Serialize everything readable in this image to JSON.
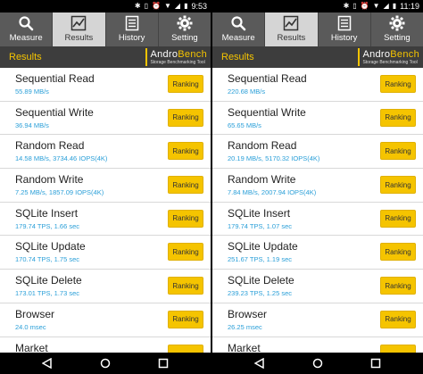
{
  "left": {
    "status": {
      "time": "9:53"
    },
    "tabs": [
      {
        "label": "Measure",
        "icon": "search-icon",
        "active": false
      },
      {
        "label": "Results",
        "icon": "chart-icon",
        "active": true
      },
      {
        "label": "History",
        "icon": "history-icon",
        "active": false
      },
      {
        "label": "Setting",
        "icon": "gear-icon",
        "active": false
      }
    ],
    "header": {
      "title": "Results",
      "brand_a": "Andro",
      "brand_b": "Bench",
      "tagline": "Storage Benchmarking Tool"
    },
    "rows": [
      {
        "name": "Sequential Read",
        "value": "55.89 MB/s",
        "button": "Ranking"
      },
      {
        "name": "Sequential Write",
        "value": "36.94 MB/s",
        "button": "Ranking"
      },
      {
        "name": "Random Read",
        "value": "14.58 MB/s, 3734.46 IOPS(4K)",
        "button": "Ranking"
      },
      {
        "name": "Random Write",
        "value": "7.25 MB/s, 1857.09 IOPS(4K)",
        "button": "Ranking"
      },
      {
        "name": "SQLite Insert",
        "value": "179.74 TPS, 1.66 sec",
        "button": "Ranking"
      },
      {
        "name": "SQLite Update",
        "value": "170.74 TPS, 1.75 sec",
        "button": "Ranking"
      },
      {
        "name": "SQLite Delete",
        "value": "173.01 TPS, 1.73 sec",
        "button": "Ranking"
      },
      {
        "name": "Browser",
        "value": "24.0 msec",
        "button": "Ranking"
      },
      {
        "name": "Market",
        "value": "",
        "button": ""
      }
    ]
  },
  "right": {
    "status": {
      "time": "11:19"
    },
    "tabs": [
      {
        "label": "Measure",
        "icon": "search-icon",
        "active": false
      },
      {
        "label": "Results",
        "icon": "chart-icon",
        "active": true
      },
      {
        "label": "History",
        "icon": "history-icon",
        "active": false
      },
      {
        "label": "Setting",
        "icon": "gear-icon",
        "active": false
      }
    ],
    "header": {
      "title": "Results",
      "brand_a": "Andro",
      "brand_b": "Bench",
      "tagline": "Storage Benchmarking Tool"
    },
    "rows": [
      {
        "name": "Sequential Read",
        "value": "220.68 MB/s",
        "button": "Ranking"
      },
      {
        "name": "Sequential Write",
        "value": "65.65 MB/s",
        "button": "Ranking"
      },
      {
        "name": "Random Read",
        "value": "20.19 MB/s, 5170.32 IOPS(4K)",
        "button": "Ranking"
      },
      {
        "name": "Random Write",
        "value": "7.84 MB/s, 2007.94 IOPS(4K)",
        "button": "Ranking"
      },
      {
        "name": "SQLite Insert",
        "value": "179.74 TPS, 1.07 sec",
        "button": "Ranking"
      },
      {
        "name": "SQLite Update",
        "value": "251.67 TPS, 1.19 sec",
        "button": "Ranking"
      },
      {
        "name": "SQLite Delete",
        "value": "239.23 TPS, 1.25 sec",
        "button": "Ranking"
      },
      {
        "name": "Browser",
        "value": "26.25 msec",
        "button": "Ranking"
      },
      {
        "name": "Market",
        "value": "",
        "button": ""
      }
    ]
  },
  "colors": {
    "accent": "#f5c400",
    "value": "#2a9fd8",
    "tabbar": "#5a5a5a",
    "tab_active": "#d5d5d5",
    "header": "#3d3d3d"
  }
}
